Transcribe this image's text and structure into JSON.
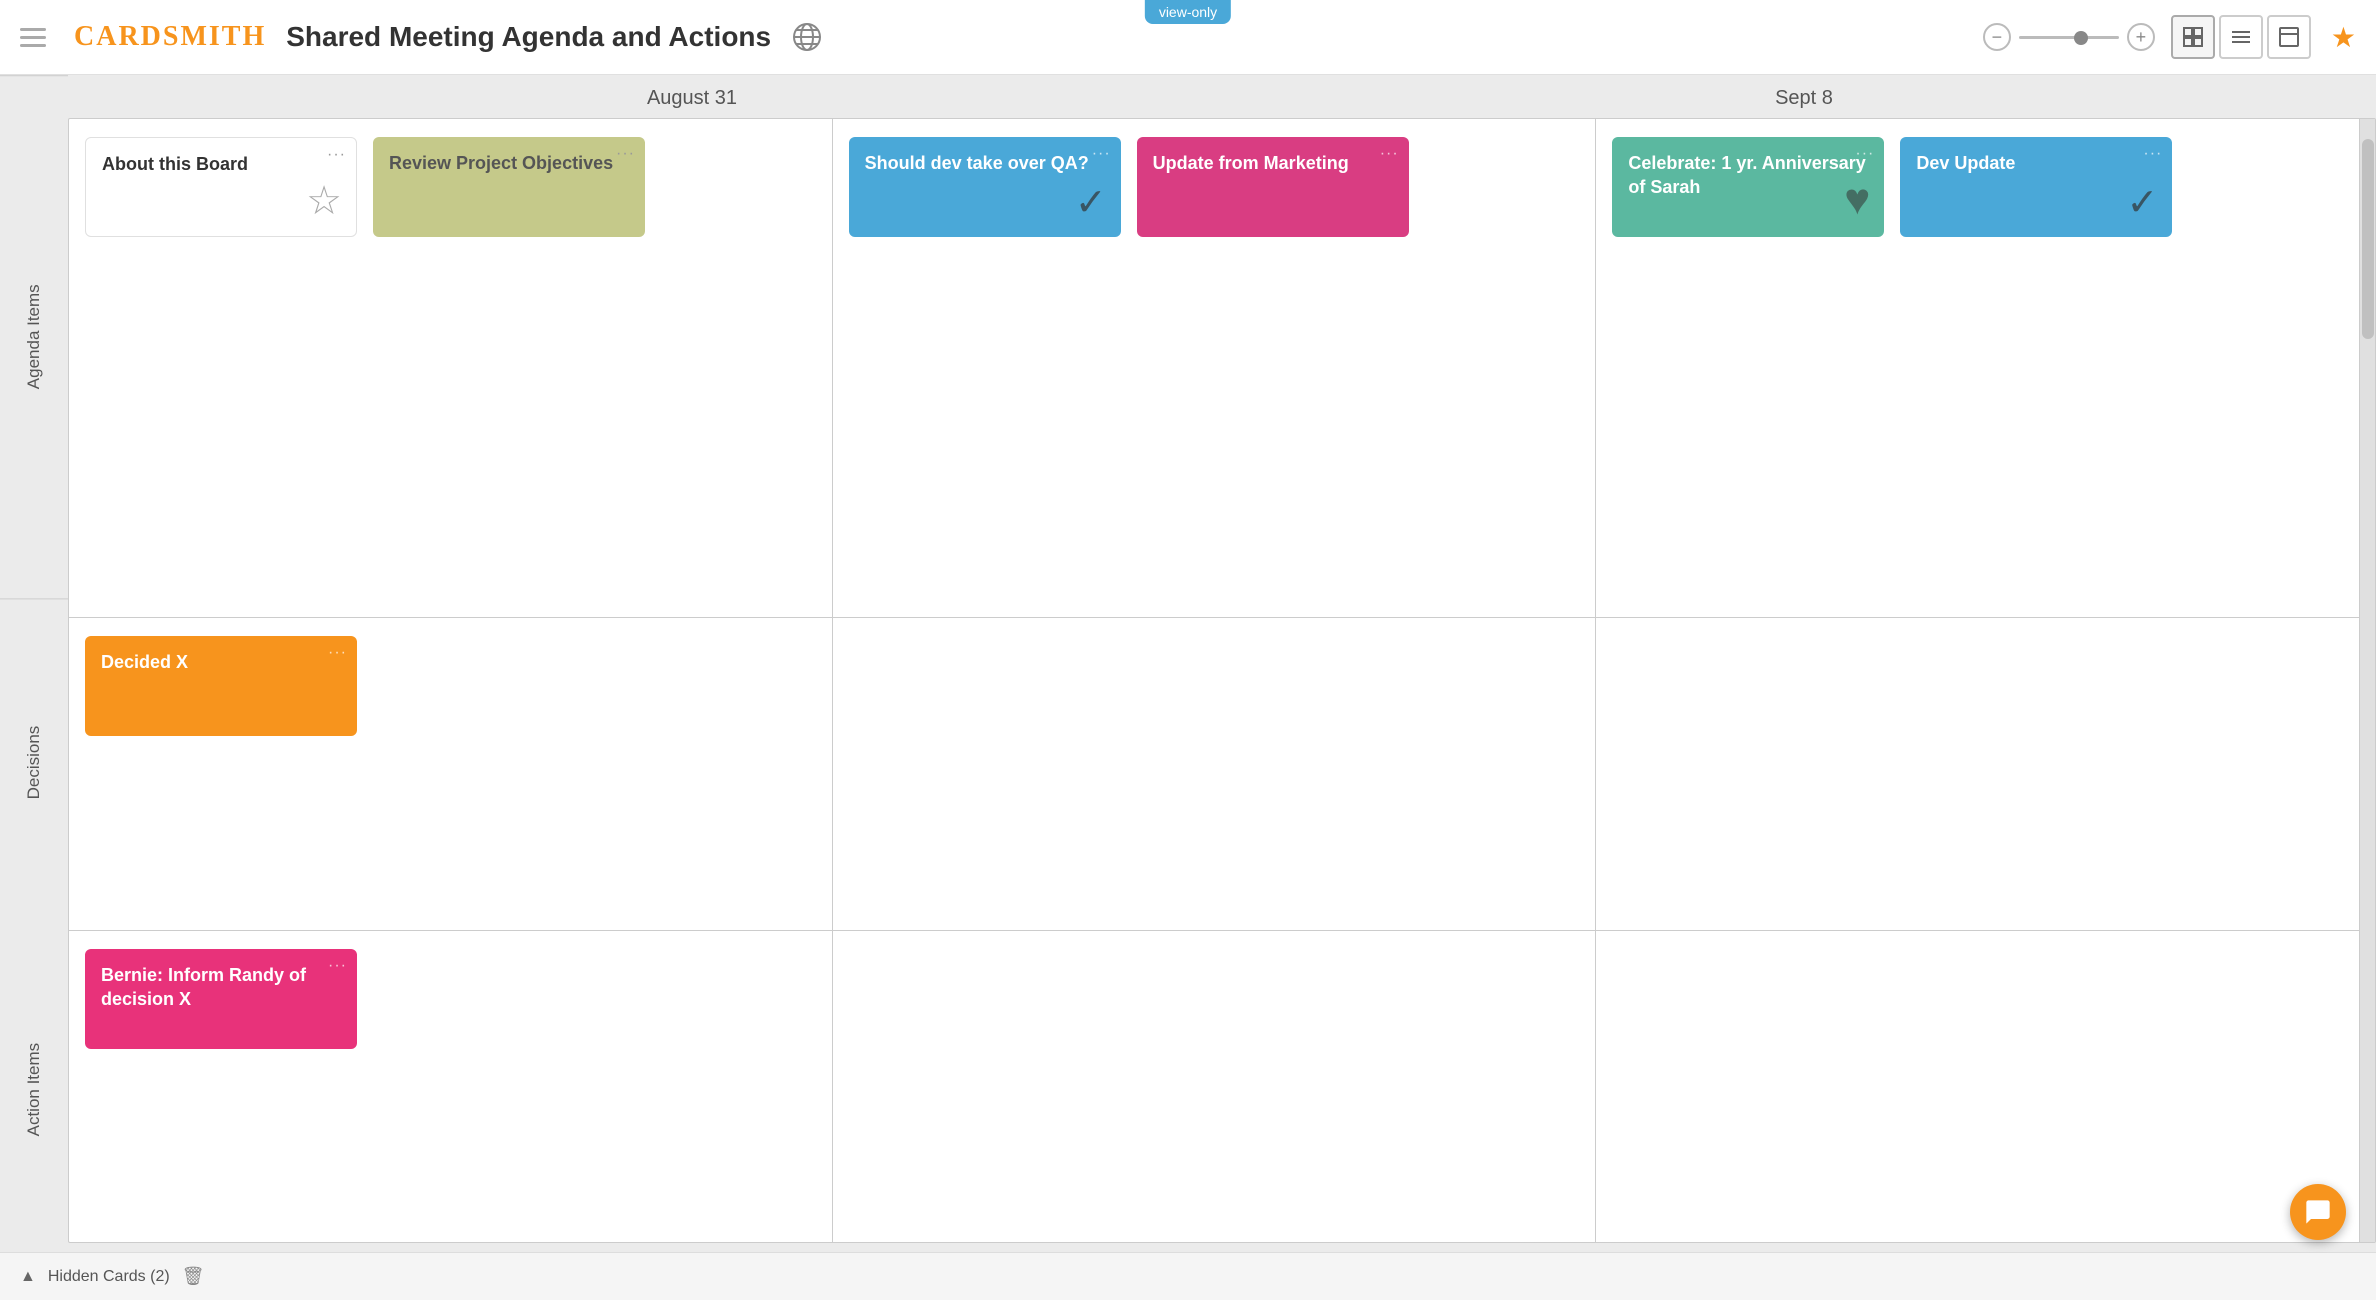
{
  "header": {
    "menu_label": "menu",
    "logo": "CARDSMITH",
    "title": "Shared Meeting Agenda and Actions",
    "view_only_badge": "view-only",
    "zoom_minus": "−",
    "zoom_plus": "+",
    "star": "★"
  },
  "columns": [
    {
      "label": "August 31"
    },
    {
      "label": "Sept 8"
    }
  ],
  "rows": [
    {
      "label": "Agenda Items",
      "key": "agenda"
    },
    {
      "label": "Decisions",
      "key": "decisions"
    },
    {
      "label": "Action Items",
      "key": "actions"
    }
  ],
  "cells": {
    "agenda_col1": [
      {
        "id": "about-board",
        "color": "white",
        "title": "About this Board",
        "icon": "☆",
        "icon_color": "#999"
      },
      {
        "id": "review-project",
        "color": "olive",
        "title": "Review Project Objectives",
        "icon": null
      }
    ],
    "agenda_col2_left": [
      {
        "id": "should-dev",
        "color": "blue",
        "title": "Should dev take over QA?",
        "icon": "✓"
      },
      {
        "id": "update-marketing",
        "color": "magenta",
        "title": "Update from Marketing",
        "icon": null
      }
    ],
    "agenda_col2_right": [
      {
        "id": "celebrate",
        "color": "green",
        "title": "Celebrate: 1 yr. Anniversary of Sarah",
        "icon": "♥"
      },
      {
        "id": "dev-update",
        "color": "blue",
        "title": "Dev Update",
        "icon": "✓"
      }
    ],
    "decisions_col1": [
      {
        "id": "decided-x",
        "color": "orange",
        "title": "Decided X",
        "icon": null
      }
    ],
    "actions_col1": [
      {
        "id": "bernie-inform",
        "color": "magenta",
        "title": "Bernie: Inform Randy of decision X",
        "icon": null
      }
    ]
  },
  "bottom_bar": {
    "arrow": "▲",
    "hidden_text": "Hidden Cards (2)",
    "trash": "🗑"
  },
  "view_buttons": [
    "⊞",
    "≡",
    "⊟"
  ]
}
